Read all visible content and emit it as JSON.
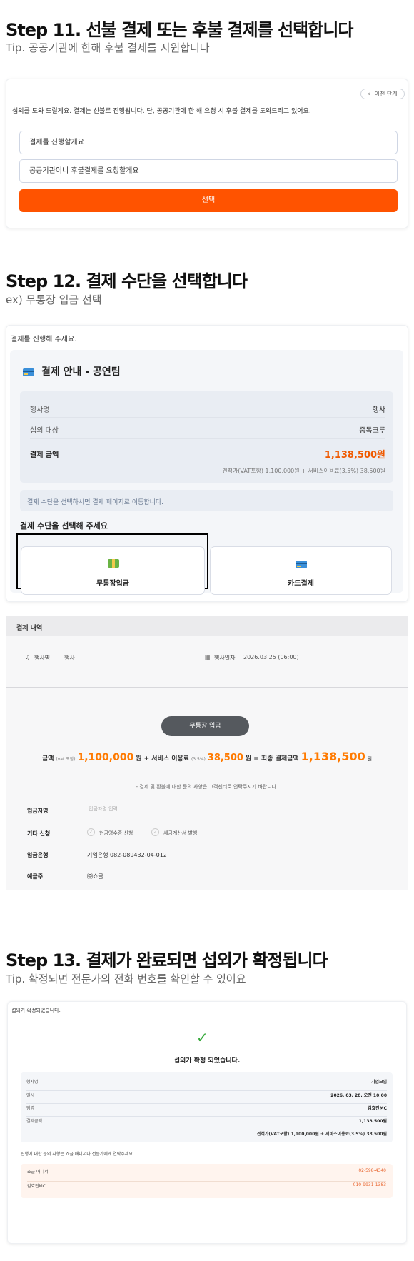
{
  "step11": {
    "title": "Step 11. 선불 결제 또는 후불 결제를 선택합니다",
    "tip": "Tip. 공공기관에 한해 후불 결제를 지원합니다",
    "back_label": "← 이전 단계",
    "message": "섭외를 도와 드릴게요. 결제는 선불로 진행됩니다. 단, 공공기관에 한 해 요청 시 후불 결제를 도와드리고 있어요.",
    "options": [
      "결제를 진행할게요",
      "공공기관이니 후불결제를 요청할게요"
    ],
    "select_label": "선택"
  },
  "step12": {
    "title": "Step 12. 결제 수단을 선택합니다",
    "sub": "ex) 무통장 입금 선택",
    "prompt": "결제를 진행해 주세요.",
    "box_title": "결제 안내 - 공연팀",
    "rows": [
      {
        "label": "행사명",
        "value": "행사"
      },
      {
        "label": "섭외 대상",
        "value": "중독크루"
      }
    ],
    "amount_label": "결제 금액",
    "amount_value": "1,138,500원",
    "amount_detail": "견적가(VAT포함) 1,100,000원 + 서비스이용료(3.5%) 38,500원",
    "notice": "결제 수단을 선택하시면 결제 페이지로 이동합니다.",
    "method_prompt": "결제 수단을 선택해 주세요",
    "methods": [
      "무통장입금",
      "카드결제"
    ],
    "colors": {
      "accent": "#ff5300",
      "amount": "#f05a00"
    }
  },
  "payment": {
    "header": "결제 내역",
    "event_label": "행사명",
    "event_value": "행사",
    "date_label": "행사일자",
    "date_value": "2026.03.25 (06:00)",
    "method_badge": "무통장 입금",
    "amount_prefix": "금액",
    "vat_note": "(vat 포함)",
    "amount": "1,100,000",
    "won_plus_fee": "원 + 서비스 이용료",
    "fee_rate": "(3.5%)",
    "fee": "38,500",
    "won_eq_total": "원 = 최종 결제금액",
    "total": "1,138,500",
    "won": "원",
    "notice": "- 결제 및 환불에 대한 문의 사항은 고객센터로 연락주시기 바랍니다.",
    "depositor_label": "입금자명",
    "depositor_placeholder": "입금자명 입력",
    "extra_label": "기타 신청",
    "extra_options": [
      "현금영수증 신청",
      "세금계산서 발행"
    ],
    "bank_label": "입금은행",
    "bank_value": "기업은행 082-089432-04-012",
    "holder_label": "예금주",
    "holder_value": "㈜쇼글"
  },
  "step13": {
    "title": "Step 13. 결제가 완료되면 섭외가 확정됩니다",
    "tip": "Tip. 확정되면 전문가의 전화 번호를 확인할 수 있어요",
    "top_text": "섭외가 확정되었습니다.",
    "check": "✓",
    "confirm_text": "섭외가 확정 되었습니다.",
    "rows": [
      {
        "label": "행사명",
        "value": "기업모임"
      },
      {
        "label": "일시",
        "value": "2026. 03. 28. 오전 10:00"
      },
      {
        "label": "팀명",
        "value": "김효진MC"
      },
      {
        "label": "결제금액",
        "value": "1,138,500원"
      }
    ],
    "amount_detail": "견적가(VAT포함) 1,100,000원 + 서비스이용료(3.5%) 38,500원",
    "contact_notice": "진행에 대한 문의 사항은 쇼글 매니저나 전문가에게 연락주세요.",
    "contacts": [
      {
        "label": "쇼글 매니저",
        "value": "02-598-4340"
      },
      {
        "label": "김효진MC",
        "value": "010-9931-1383"
      }
    ]
  }
}
